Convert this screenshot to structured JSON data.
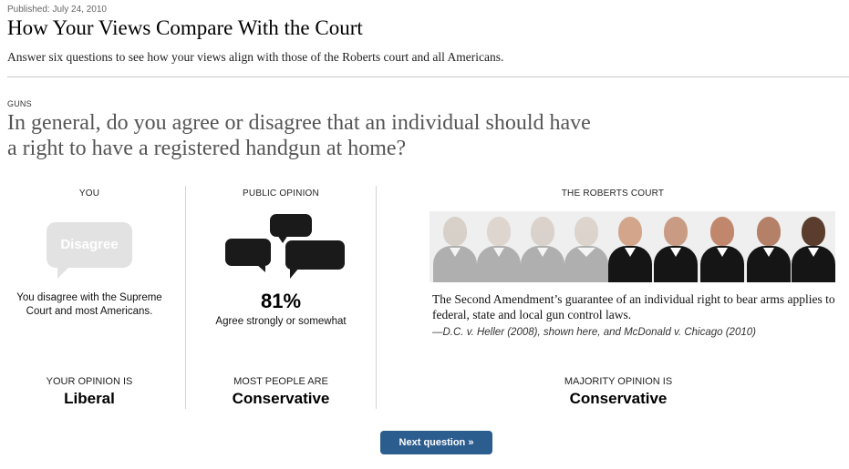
{
  "header": {
    "published": "Published: July 24, 2010",
    "title": "How Your Views Compare With the Court",
    "subtitle": "Answer six questions to see how your views align with those of the Roberts court and all Americans."
  },
  "question": {
    "category": "GUNS",
    "text": "In general, do you agree or disagree that an individual should have a right to have a registered handgun at home?"
  },
  "you": {
    "heading": "YOU",
    "answer": "Disagree",
    "description": "You disagree with the Supreme Court and most Americans.",
    "opinion_label": "YOUR OPINION IS",
    "opinion_value": "Liberal"
  },
  "public": {
    "heading": "PUBLIC OPINION",
    "percent": "81%",
    "description": "Agree strongly or somewhat",
    "opinion_label": "MOST PEOPLE ARE",
    "opinion_value": "Conservative"
  },
  "court": {
    "heading": "THE ROBERTS COURT",
    "ruling": "The Second Amendment’s guarantee of an individual right to bear arms applies to federal, state and local gun control laws.",
    "citation": "—D.C. v. Heller (2008), shown here, and McDonald v. Chicago (2010)",
    "opinion_label": "MAJORITY OPINION IS",
    "opinion_value": "Conservative",
    "justice_count": 9,
    "majority_count": 5
  },
  "next_button": {
    "label": "Next question »"
  },
  "colors": {
    "button": "#2c5d8f",
    "bubble_you": "#e2e2e2",
    "bubble_public": "#1a1a1a",
    "question_text": "#555555"
  }
}
